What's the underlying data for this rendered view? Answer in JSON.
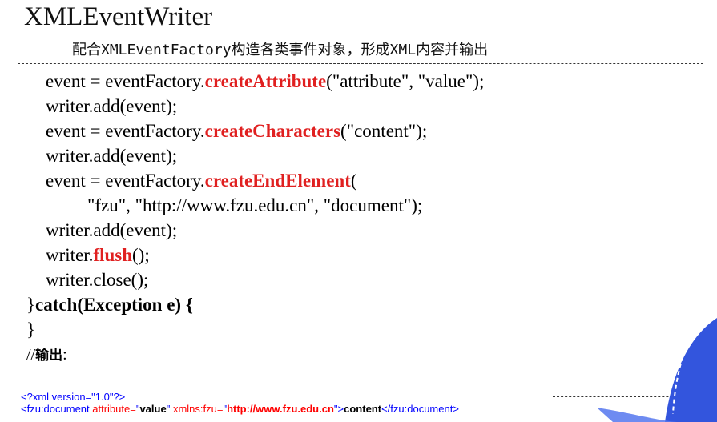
{
  "title": "XMLEventWriter",
  "subtitle": "配合XMLEventFactory构造各类事件对象，形成XML内容并输出",
  "code": {
    "l1_pre": "event = eventFactory.",
    "l1_hl": "createAttribute",
    "l1_post": "(\"attribute\", \"value\");",
    "l2": "writer.add(event);",
    "l3_pre": "event = eventFactory.",
    "l3_hl": "createCharacters",
    "l3_post": "(\"content\");",
    "l4": "writer.add(event);",
    "l5_pre": "event = eventFactory.",
    "l5_hl": "createEndElement",
    "l5_post": "(",
    "l6": "\"fzu\", \"http://www.fzu.edu.cn\", \"document\");",
    "l7": "writer.add(event);",
    "l8_pre": "writer.",
    "l8_hl": "flush",
    "l8_post": "();",
    "l9": "writer.close();",
    "l10_brace": "}",
    "l10_catch": "catch(Exception e) {",
    "l11": "}",
    "l12_pre": "//",
    "l12_bold": "输出",
    "l12_post": ":"
  },
  "xml_output": {
    "line1": "<?xml version=\"1.0\"?>",
    "line2_open": "<fzu:document ",
    "line2_attr1": "attribute=",
    "line2_q1": "\"",
    "line2_val1": "value",
    "line2_q2": "\" ",
    "line2_attr2": "xmlns:fzu=",
    "line2_q3": "\"",
    "line2_val2": "http://www.fzu.edu.cn",
    "line2_q4": "\"",
    "line2_gt": ">",
    "line2_content": "content",
    "line2_close": "</fzu:document>"
  },
  "colors": {
    "highlight": "#e02020",
    "xml_blue": "#0000ff",
    "xml_attr": "#ff0000",
    "deco_blue": "#3355dd"
  }
}
